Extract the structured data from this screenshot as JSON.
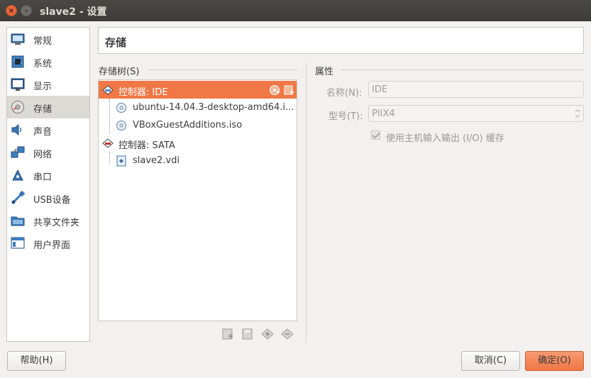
{
  "window": {
    "title": "slave2 - 设置"
  },
  "sidebar": {
    "items": [
      {
        "label": "常规",
        "icon": "general-icon"
      },
      {
        "label": "系统",
        "icon": "system-icon"
      },
      {
        "label": "显示",
        "icon": "display-icon"
      },
      {
        "label": "存储",
        "icon": "storage-icon",
        "active": true
      },
      {
        "label": "声音",
        "icon": "audio-icon"
      },
      {
        "label": "网络",
        "icon": "network-icon"
      },
      {
        "label": "串口",
        "icon": "serial-port-icon"
      },
      {
        "label": "USB设备",
        "icon": "usb-icon"
      },
      {
        "label": "共享文件夹",
        "icon": "shared-folder-icon"
      },
      {
        "label": "用户界面",
        "icon": "user-interface-icon"
      }
    ]
  },
  "header": {
    "title": "存储"
  },
  "storage_tree": {
    "label": "存储树(S)",
    "items": [
      {
        "label": "控制器: IDE",
        "type": "controller",
        "selected": true
      },
      {
        "label": "ubuntu-14.04.3-desktop-amd64.i...",
        "type": "optical"
      },
      {
        "label": "VBoxGuestAdditions.iso",
        "type": "optical"
      },
      {
        "label": "控制器: SATA",
        "type": "controller"
      },
      {
        "label": "slave2.vdi",
        "type": "disk"
      }
    ]
  },
  "attributes": {
    "label": "属性",
    "name_label": "名称(N):",
    "name_value": "IDE",
    "type_label": "型号(T):",
    "type_value": "PIIX4",
    "host_io_label": "使用主机输入输出 (I/O) 缓存",
    "host_io_checked": true
  },
  "buttons": {
    "help": "帮助(H)",
    "cancel": "取消(C)",
    "ok": "确定(O)"
  },
  "colors": {
    "accent": "#f07746",
    "titlebar": "#3c3b37"
  }
}
